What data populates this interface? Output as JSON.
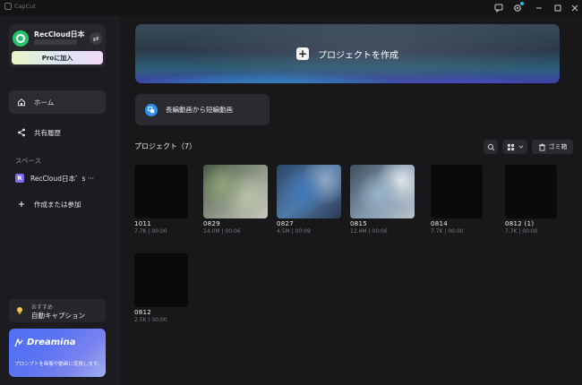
{
  "titlebar": {
    "app_name": "CapCut"
  },
  "sidebar": {
    "account": {
      "name": "RecCloud日本",
      "pro_label": "Proに加入"
    },
    "nav": [
      {
        "label": "ホーム"
      },
      {
        "label": "共有履歴"
      }
    ],
    "spaces_label": "スペース",
    "space": {
      "badge": "R",
      "name": "RecCloud日本゛s ···"
    },
    "join_label": "作成または参加",
    "caption": {
      "small": "おすすめ",
      "main": "自動キャプション"
    },
    "dreamina": {
      "title": "Dreamina",
      "desc": "プロンプトを画像や動画に変換します。"
    }
  },
  "main": {
    "hero_label": "プロジェクトを作成",
    "long_to_short_label": "長編動画から短編動画",
    "projects_title": "プロジェクト（7）",
    "trash_label": "ゴミ箱",
    "projects": [
      {
        "name": "1011",
        "meta": "7.7K | 00:00"
      },
      {
        "name": "0829",
        "meta": "14.0M | 00:06"
      },
      {
        "name": "0827",
        "meta": "4.5M | 00:09"
      },
      {
        "name": "0815",
        "meta": "12.4M | 00:06"
      },
      {
        "name": "0814",
        "meta": "7.7K | 00:00"
      },
      {
        "name": "0812 (1)",
        "meta": "7.7K | 00:00"
      },
      {
        "name": "0812",
        "meta": "2.5K | 00:00"
      }
    ]
  },
  "colors": {
    "accent": "#22c1d6",
    "pro_gradient": "#e9f7c4",
    "space_badge": "#7b6cf0"
  }
}
